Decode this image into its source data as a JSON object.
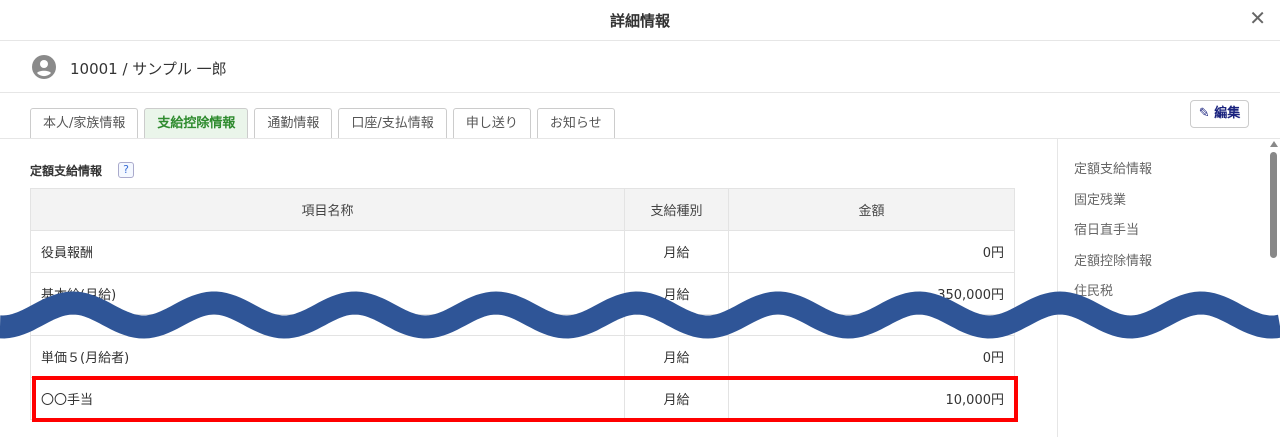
{
  "header": {
    "title": "詳細情報"
  },
  "user": {
    "label": "10001 / サンプル 一郎"
  },
  "tabs": [
    {
      "label": "本人/家族情報"
    },
    {
      "label": "支給控除情報"
    },
    {
      "label": "通勤情報"
    },
    {
      "label": "口座/支払情報"
    },
    {
      "label": "申し送り"
    },
    {
      "label": "お知らせ"
    }
  ],
  "edit_label": "編集",
  "section": {
    "title": "定額支給情報",
    "help": "?"
  },
  "table": {
    "headers": [
      "項目名称",
      "支給種別",
      "金額"
    ],
    "rows": [
      [
        "役員報酬",
        "月給",
        "0円"
      ],
      [
        "基本給(月給)",
        "月給",
        "350,000円"
      ],
      [
        "単価５(月給者)",
        "月給",
        "0円"
      ],
      [
        "〇〇手当",
        "月給",
        "10,000円"
      ]
    ]
  },
  "rightnav": [
    "定額支給情報",
    "固定残業",
    "宿日直手当",
    "定額控除情報",
    "住民税"
  ],
  "colors": {
    "active_tab": "#2e8b2e",
    "wave": "#2f5597",
    "highlight": "#ff0000"
  }
}
